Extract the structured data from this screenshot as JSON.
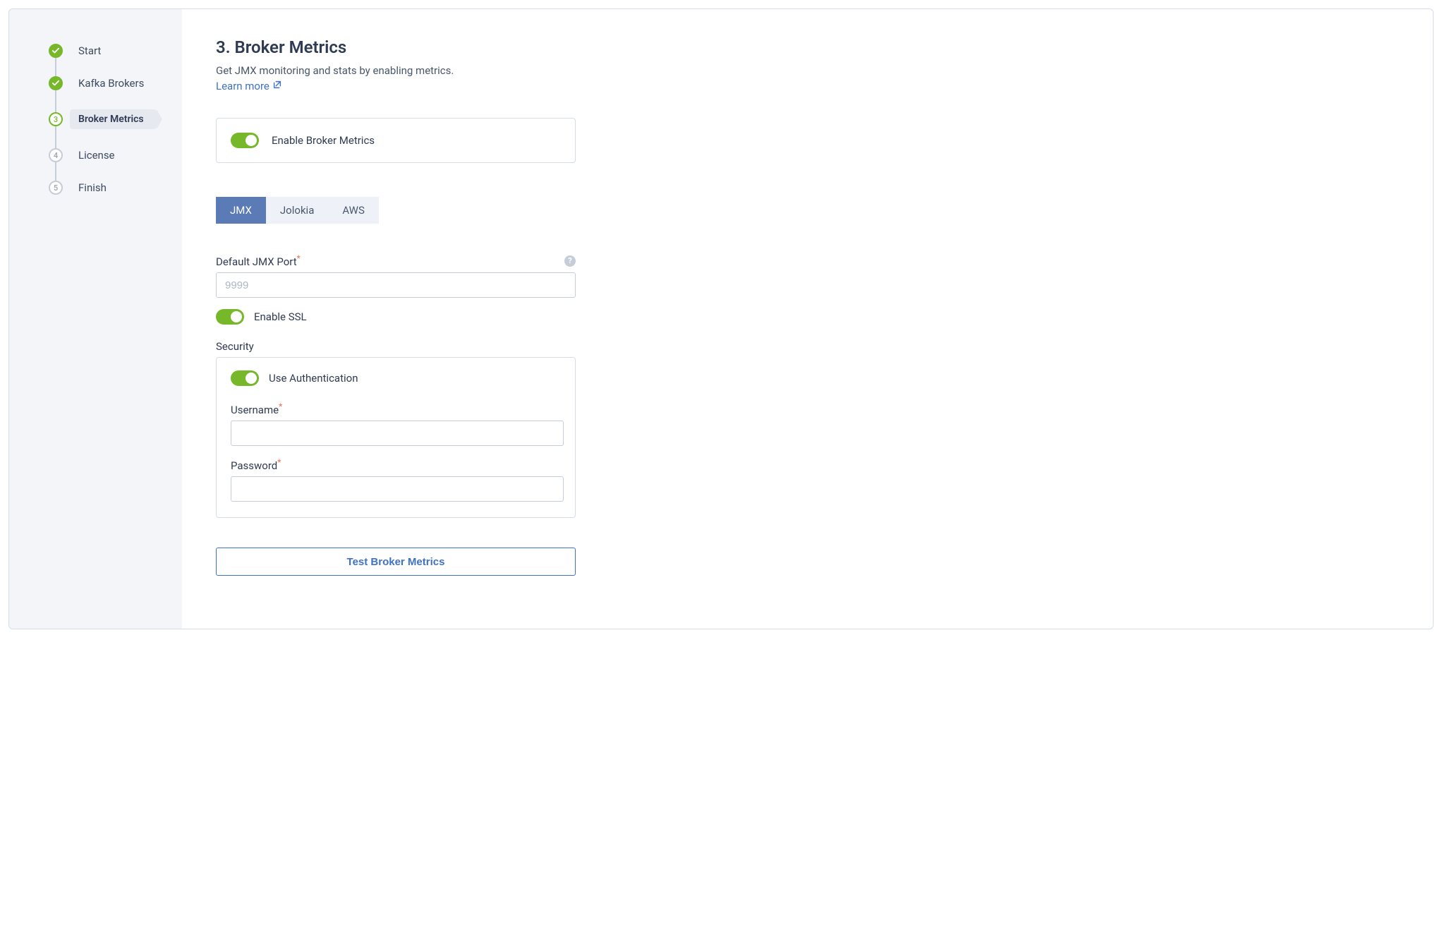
{
  "sidebar": {
    "steps": [
      {
        "label": "Start",
        "state": "done"
      },
      {
        "label": "Kafka Brokers",
        "state": "done"
      },
      {
        "label": "Broker Metrics",
        "state": "current",
        "number": "3"
      },
      {
        "label": "License",
        "state": "future",
        "number": "4"
      },
      {
        "label": "Finish",
        "state": "future",
        "number": "5"
      }
    ]
  },
  "header": {
    "title": "3. Broker Metrics",
    "subtitle": "Get JMX monitoring and stats by enabling metrics.",
    "learn_more": "Learn more"
  },
  "enable_panel": {
    "label": "Enable Broker Metrics"
  },
  "tabs": [
    {
      "label": "JMX",
      "active": true
    },
    {
      "label": "Jolokia",
      "active": false
    },
    {
      "label": "AWS",
      "active": false
    }
  ],
  "form": {
    "jmx_port_label": "Default JMX Port",
    "jmx_port_placeholder": "9999",
    "enable_ssl_label": "Enable SSL",
    "security_label": "Security",
    "use_auth_label": "Use Authentication",
    "username_label": "Username",
    "password_label": "Password"
  },
  "actions": {
    "test_button": "Test Broker Metrics"
  }
}
